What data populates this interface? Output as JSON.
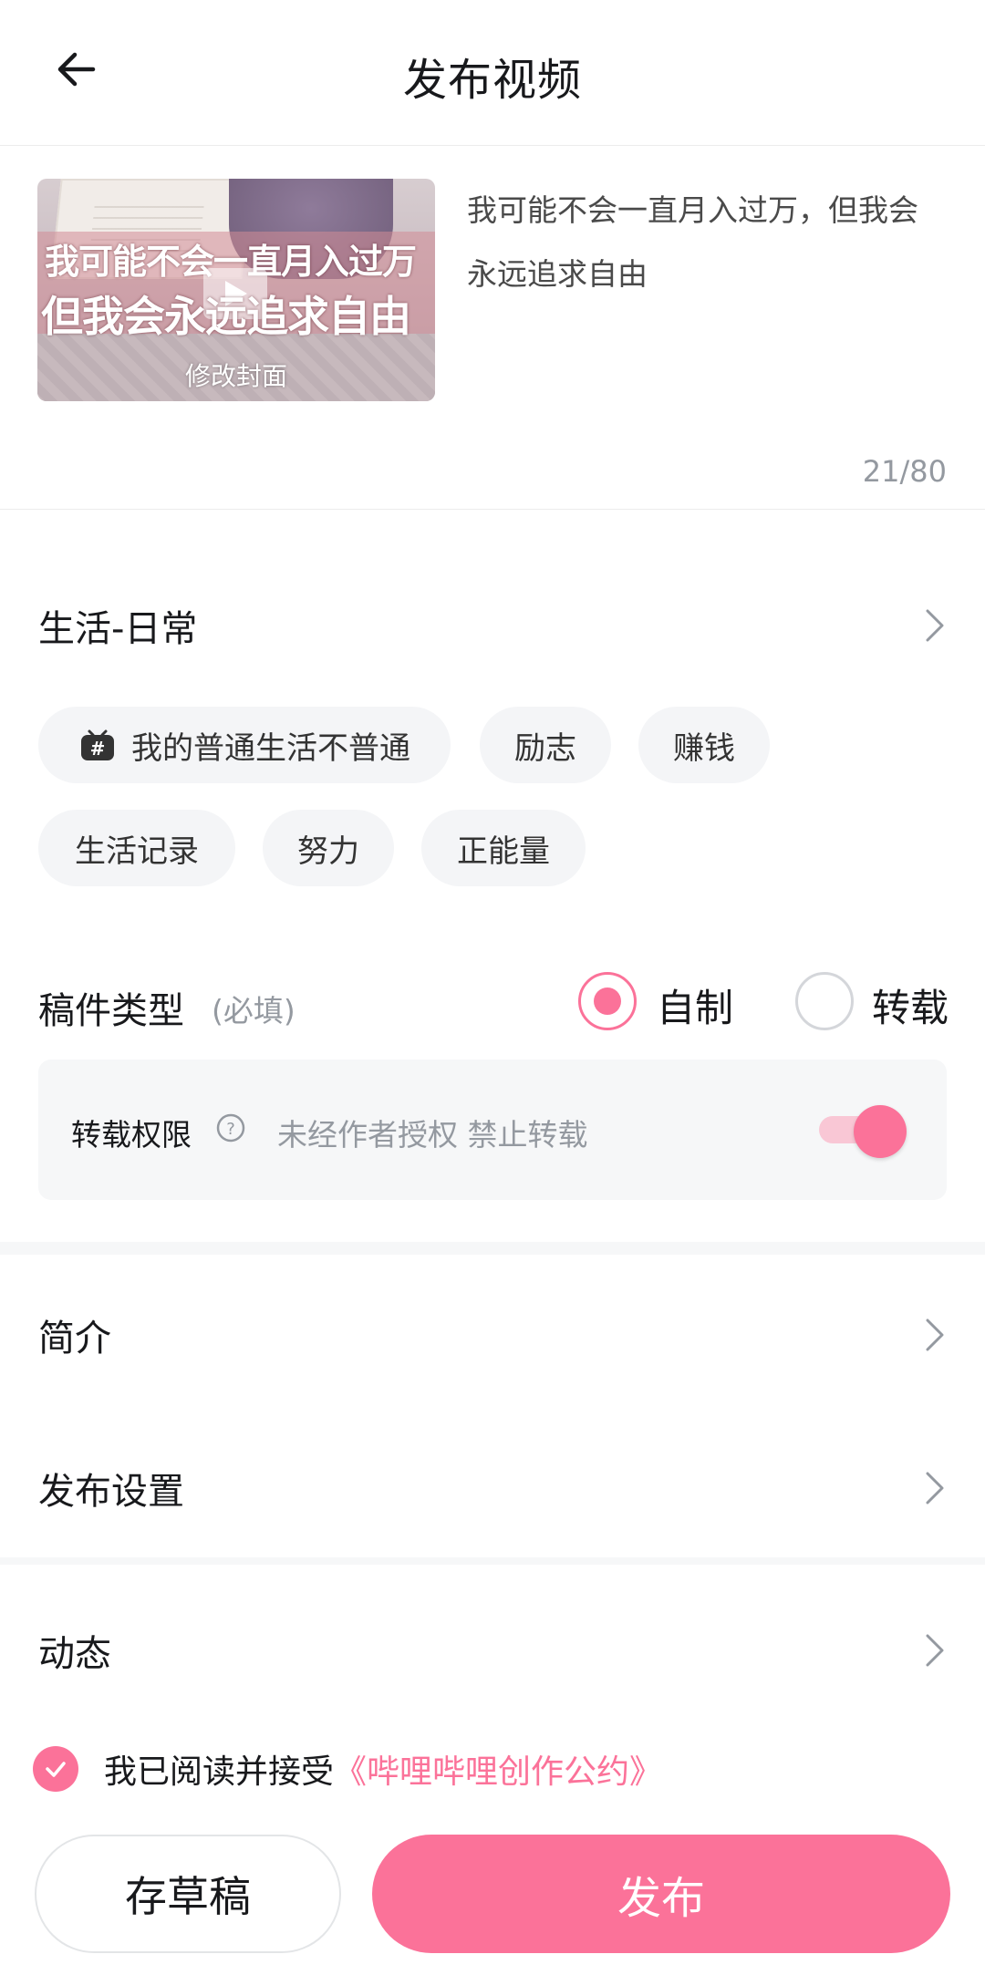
{
  "header": {
    "title": "发布视频"
  },
  "cover": {
    "overlay_line1": "我可能不会一直月入过万",
    "overlay_line2": "但我会永远追求自由",
    "edit_label": "修改封面"
  },
  "title_input": {
    "value": "我可能不会一直月入过万，但我会永远追求自由",
    "char_count": "21/80"
  },
  "category": {
    "label": "生活-日常"
  },
  "tags": [
    {
      "label": "我的普通生活不普通",
      "icon": "bilibili-tv-topic-icon"
    },
    {
      "label": "励志"
    },
    {
      "label": "赚钱"
    },
    {
      "label": "生活记录"
    },
    {
      "label": "努力"
    },
    {
      "label": "正能量"
    }
  ],
  "manuscript_type": {
    "label": "稿件类型",
    "required": "(必填)",
    "options": [
      {
        "label": "自制",
        "selected": true
      },
      {
        "label": "转载",
        "selected": false
      }
    ]
  },
  "repost_permission": {
    "label": "转载权限",
    "description": "未经作者授权 禁止转载",
    "enabled": true
  },
  "intro": {
    "label": "简介"
  },
  "publish_settings": {
    "label": "发布设置"
  },
  "dynamic": {
    "label": "动态"
  },
  "agreement": {
    "checked": true,
    "text": "我已阅读并接受",
    "link": "《哔哩哔哩创作公约》"
  },
  "actions": {
    "draft_label": "存草稿",
    "publish_label": "发布"
  },
  "colors": {
    "accent": "#fb7299",
    "text": "#18191c",
    "muted": "#9499a0",
    "panel": "#f6f7f8"
  }
}
